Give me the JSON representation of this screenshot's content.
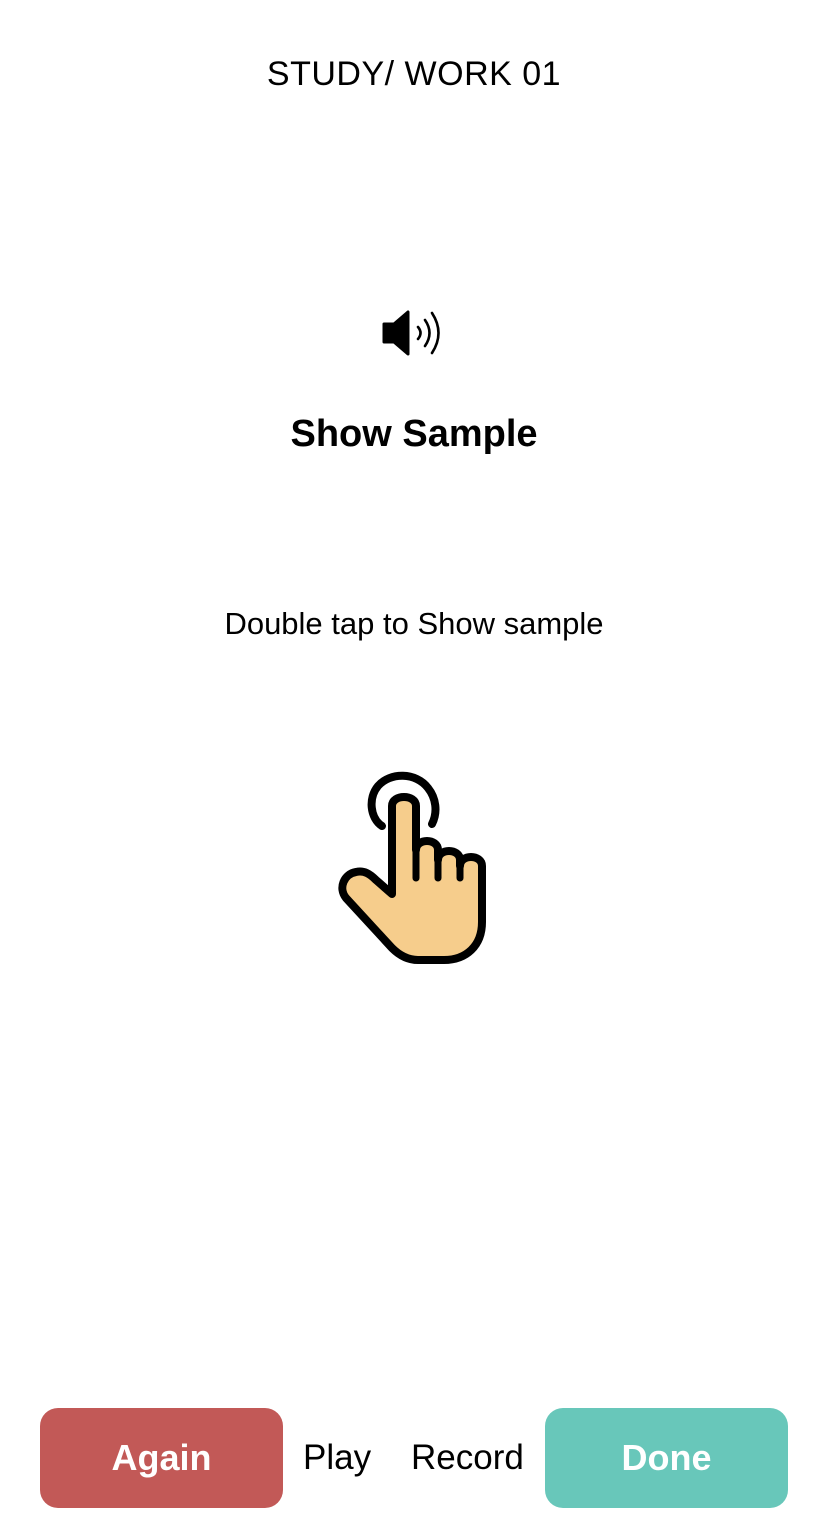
{
  "header": {
    "title": "STUDY/ WORK 01"
  },
  "main": {
    "audio_icon": "speaker-icon",
    "heading": "Show Sample",
    "hint": "Double tap to Show sample",
    "gesture_icon": "tap-hand-icon"
  },
  "toolbar": {
    "again_label": "Again",
    "play_label": "Play",
    "record_label": "Record",
    "done_label": "Done"
  },
  "colors": {
    "again": "#c25957",
    "done": "#68c7ba",
    "hand_fill": "#f6cd8c"
  }
}
